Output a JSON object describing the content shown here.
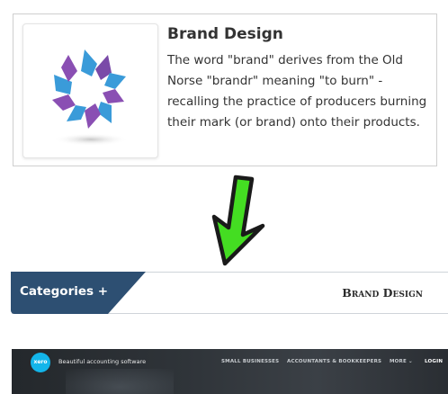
{
  "card": {
    "title": "Brand Design",
    "description": "The word \"brand\" derives from the Old Norse \"brandr\" meaning \"to burn\" - recalling the practice of producers burning their mark (or brand) onto their products.",
    "thumbnail_icon": "brand-logo-icon",
    "colors": {
      "blue": "#3a9bd9",
      "purple": "#8a4fb3"
    }
  },
  "arrow": {
    "icon": "green-arrow-down-icon",
    "color": "#44dd22"
  },
  "categories_bar": {
    "tab_label": "Categories +",
    "breadcrumb": "Brand Design",
    "colors": {
      "tab": "#2d4f72"
    }
  },
  "website_preview": {
    "logo_text": "xero",
    "tagline": "Beautiful accounting software",
    "nav": [
      "SMALL BUSINESSES",
      "ACCOUNTANTS & BOOKKEEPERS",
      "MORE ⌄",
      "LOGIN"
    ],
    "colors": {
      "logo": "#13b5ea"
    }
  }
}
